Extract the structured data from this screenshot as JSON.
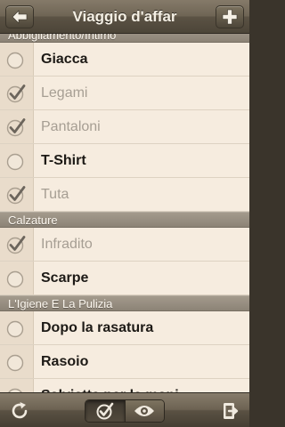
{
  "app": {
    "title": "Viaggio d'affar",
    "back_icon": "arrow-left-icon",
    "add_icon": "plus-icon"
  },
  "sections": [
    {
      "header": "Abbigliamento/Intimo",
      "items": [
        {
          "label": "Giacca",
          "checked": false
        },
        {
          "label": "Legami",
          "checked": true
        },
        {
          "label": "Pantaloni",
          "checked": true
        },
        {
          "label": "T-Shirt",
          "checked": false
        },
        {
          "label": "Tuta",
          "checked": true
        }
      ]
    },
    {
      "header": "Calzature",
      "items": [
        {
          "label": "Infradito",
          "checked": true
        },
        {
          "label": "Scarpe",
          "checked": false
        }
      ]
    },
    {
      "header": "L'Igiene E La Pulizia",
      "items": [
        {
          "label": "Dopo la rasatura",
          "checked": false
        },
        {
          "label": "Rasoio",
          "checked": false
        },
        {
          "label": "Salviette per le mani",
          "checked": false
        }
      ]
    }
  ],
  "toolbar": {
    "refresh_icon": "refresh-icon",
    "segment_left_icon": "checklist-icon",
    "segment_right_icon": "eye-icon",
    "active_segment": "checklist",
    "export_icon": "export-icon"
  },
  "colors": {
    "bar": "#6f6555",
    "list_background": "#f6ecdf",
    "section_header": "#958c7f",
    "checked_text": "#a69e93",
    "unchecked_text": "#1d1a16"
  }
}
